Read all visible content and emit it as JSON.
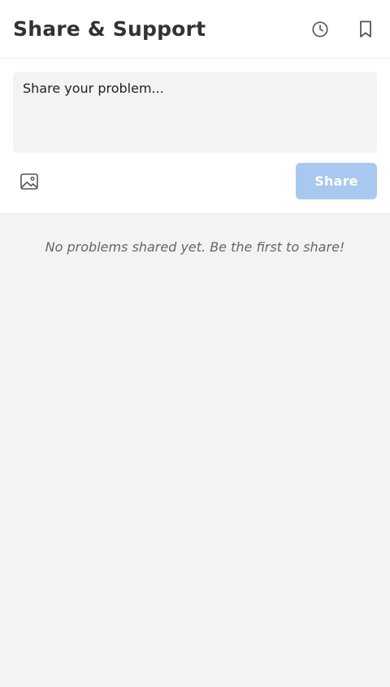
{
  "header": {
    "title": "Share & Support",
    "actions": [
      {
        "icon": "history-icon"
      },
      {
        "icon": "bookmark-icon"
      }
    ]
  },
  "composer": {
    "placeholder": "Share your problem...",
    "value": "",
    "image_icon": "image-icon",
    "share_label": "Share",
    "share_disabled_color": "#a9c8ef"
  },
  "feed": {
    "empty_message": "No problems shared yet. Be the first to share!"
  },
  "colors": {
    "page_background": "#f3f3f3",
    "surface": "#ffffff",
    "title_text": "#333333",
    "muted_text": "#666666",
    "icon": "#555555"
  }
}
